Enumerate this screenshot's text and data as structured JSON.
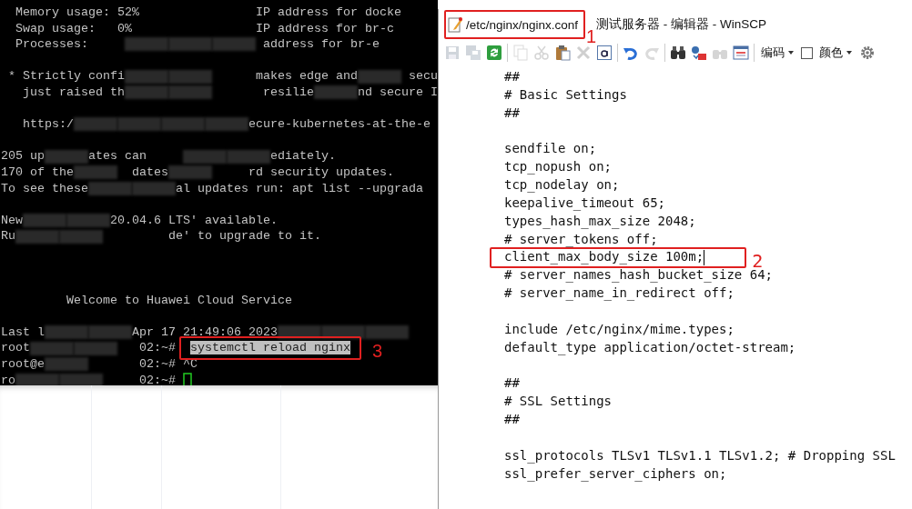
{
  "terminal": {
    "lines": [
      {
        "kind": "line",
        "parts": [
          {
            "kind": "text",
            "text": "  Memory usage: 52%                IP address for docke"
          }
        ]
      },
      {
        "kind": "line",
        "parts": [
          {
            "kind": "text",
            "text": "  Swap usage:   0%                 IP address for br-c"
          }
        ]
      },
      {
        "kind": "line",
        "parts": [
          {
            "kind": "text",
            "text": "  Processes:     "
          },
          {
            "kind": "redaction"
          },
          {
            "kind": "redaction"
          },
          {
            "kind": "redaction"
          },
          {
            "kind": "text",
            "text": " address for br-e"
          }
        ]
      },
      {
        "kind": "blank"
      },
      {
        "kind": "line",
        "parts": [
          {
            "kind": "text",
            "text": " * Strictly confi"
          },
          {
            "kind": "redaction"
          },
          {
            "kind": "redaction"
          },
          {
            "kind": "text",
            "text": "      makes edge and"
          },
          {
            "kind": "redaction"
          },
          {
            "kind": "text",
            "text": " secu"
          }
        ]
      },
      {
        "kind": "line",
        "parts": [
          {
            "kind": "text",
            "text": "   just raised th"
          },
          {
            "kind": "redaction"
          },
          {
            "kind": "redaction"
          },
          {
            "kind": "text",
            "text": "       resilie"
          },
          {
            "kind": "redaction"
          },
          {
            "kind": "text",
            "text": "nd secure I"
          }
        ]
      },
      {
        "kind": "blank"
      },
      {
        "kind": "line",
        "parts": [
          {
            "kind": "text",
            "text": "   https:/"
          },
          {
            "kind": "redaction"
          },
          {
            "kind": "redaction"
          },
          {
            "kind": "redaction"
          },
          {
            "kind": "redaction"
          },
          {
            "kind": "text",
            "text": "ecure-kubernetes-at-the-e"
          }
        ]
      },
      {
        "kind": "blank"
      },
      {
        "kind": "line",
        "parts": [
          {
            "kind": "text",
            "text": "205 up"
          },
          {
            "kind": "redaction"
          },
          {
            "kind": "text",
            "text": "ates can     "
          },
          {
            "kind": "redaction"
          },
          {
            "kind": "redaction"
          },
          {
            "kind": "text",
            "text": "ediately."
          }
        ]
      },
      {
        "kind": "line",
        "parts": [
          {
            "kind": "text",
            "text": "170 of the"
          },
          {
            "kind": "redaction"
          },
          {
            "kind": "text",
            "text": "  dates"
          },
          {
            "kind": "redaction"
          },
          {
            "kind": "text",
            "text": "     rd security updates."
          }
        ]
      },
      {
        "kind": "line",
        "parts": [
          {
            "kind": "text",
            "text": "To see these"
          },
          {
            "kind": "redaction"
          },
          {
            "kind": "redaction"
          },
          {
            "kind": "text",
            "text": "al updates run: apt list --upgrada"
          }
        ]
      },
      {
        "kind": "blank"
      },
      {
        "kind": "line",
        "parts": [
          {
            "kind": "text",
            "text": "New"
          },
          {
            "kind": "redaction"
          },
          {
            "kind": "redaction"
          },
          {
            "kind": "text",
            "text": "20.04.6 LTS' available."
          }
        ]
      },
      {
        "kind": "line",
        "parts": [
          {
            "kind": "text",
            "text": "Ru"
          },
          {
            "kind": "redaction"
          },
          {
            "kind": "redaction"
          },
          {
            "kind": "text",
            "text": "         de' to upgrade to it."
          }
        ]
      },
      {
        "kind": "blank"
      },
      {
        "kind": "blank"
      },
      {
        "kind": "blank"
      },
      {
        "kind": "line",
        "parts": [
          {
            "kind": "text",
            "text": "         Welcome to Huawei Cloud Service"
          }
        ]
      },
      {
        "kind": "blank"
      },
      {
        "kind": "line",
        "parts": [
          {
            "kind": "text",
            "text": "Last l"
          },
          {
            "kind": "redaction"
          },
          {
            "kind": "redaction"
          },
          {
            "kind": "text",
            "text": "Apr 17 21:49:06 2023"
          },
          {
            "kind": "redaction"
          },
          {
            "kind": "redaction"
          },
          {
            "kind": "redaction"
          }
        ]
      },
      {
        "kind": "line",
        "parts": [
          {
            "kind": "text",
            "text": "root"
          },
          {
            "kind": "redaction"
          },
          {
            "kind": "redaction"
          },
          {
            "kind": "text",
            "text": "   02:~# "
          },
          {
            "kind": "selected",
            "text": "systemctl reload nginx",
            "annotation": "3"
          }
        ]
      },
      {
        "kind": "line",
        "parts": [
          {
            "kind": "text",
            "text": "root@e"
          },
          {
            "kind": "redaction"
          },
          {
            "kind": "text",
            "text": "       02:~# ^C"
          }
        ]
      },
      {
        "kind": "line",
        "parts": [
          {
            "kind": "text",
            "text": "ro"
          },
          {
            "kind": "redaction"
          },
          {
            "kind": "redaction"
          },
          {
            "kind": "text",
            "text": "     02:~# "
          },
          {
            "kind": "cursor"
          }
        ]
      }
    ]
  },
  "editor": {
    "title": {
      "file": "/etc/nginx/nginx.conf",
      "rest": "测试服务器 - 编辑器 - WinSCP",
      "annotation": "1"
    },
    "toolbar": [
      {
        "kind": "save",
        "disabled": true
      },
      {
        "kind": "save-all",
        "disabled": true
      },
      {
        "kind": "reload",
        "disabled": false
      },
      {
        "kind": "separator"
      },
      {
        "kind": "copy",
        "disabled": true
      },
      {
        "kind": "cut",
        "disabled": true
      },
      {
        "kind": "paste",
        "disabled": false
      },
      {
        "kind": "delete",
        "disabled": true
      },
      {
        "kind": "select-all",
        "disabled": false
      },
      {
        "kind": "separator"
      },
      {
        "kind": "undo",
        "disabled": false
      },
      {
        "kind": "redo",
        "disabled": true
      },
      {
        "kind": "separator"
      },
      {
        "kind": "find",
        "disabled": false
      },
      {
        "kind": "replace",
        "disabled": false
      },
      {
        "kind": "find-next",
        "disabled": true
      },
      {
        "kind": "goto",
        "disabled": false
      },
      {
        "kind": "separator"
      },
      {
        "kind": "menu",
        "label": "编码"
      },
      {
        "kind": "checkbox",
        "label": "颜色",
        "checked": false
      },
      {
        "kind": "settings",
        "disabled": false
      }
    ],
    "lines": [
      {
        "kind": "code",
        "text": "##"
      },
      {
        "kind": "code",
        "text": "# Basic Settings"
      },
      {
        "kind": "code",
        "text": "##"
      },
      {
        "kind": "blank"
      },
      {
        "kind": "code",
        "text": "sendfile on;"
      },
      {
        "kind": "code",
        "text": "tcp_nopush on;"
      },
      {
        "kind": "code",
        "text": "tcp_nodelay on;"
      },
      {
        "kind": "code",
        "text": "keepalive_timeout 65;"
      },
      {
        "kind": "code",
        "text": "types_hash_max_size 2048;"
      },
      {
        "kind": "code",
        "text": "# server_tokens off;"
      },
      {
        "kind": "code",
        "text": "client_max_body_size 100m;",
        "caret": true,
        "annotation": "2"
      },
      {
        "kind": "code",
        "text": "# server_names_hash_bucket_size 64;"
      },
      {
        "kind": "code",
        "text": "# server_name_in_redirect off;"
      },
      {
        "kind": "blank"
      },
      {
        "kind": "code",
        "text": "include /etc/nginx/mime.types;"
      },
      {
        "kind": "code",
        "text": "default_type application/octet-stream;"
      },
      {
        "kind": "blank"
      },
      {
        "kind": "code",
        "text": "##"
      },
      {
        "kind": "code",
        "text": "# SSL Settings"
      },
      {
        "kind": "code",
        "text": "##"
      },
      {
        "kind": "blank"
      },
      {
        "kind": "code",
        "text": "ssl_protocols TLSv1 TLSv1.1 TLSv1.2; # Dropping SSL"
      },
      {
        "kind": "code",
        "text": "ssl_prefer_server_ciphers on;"
      }
    ]
  }
}
